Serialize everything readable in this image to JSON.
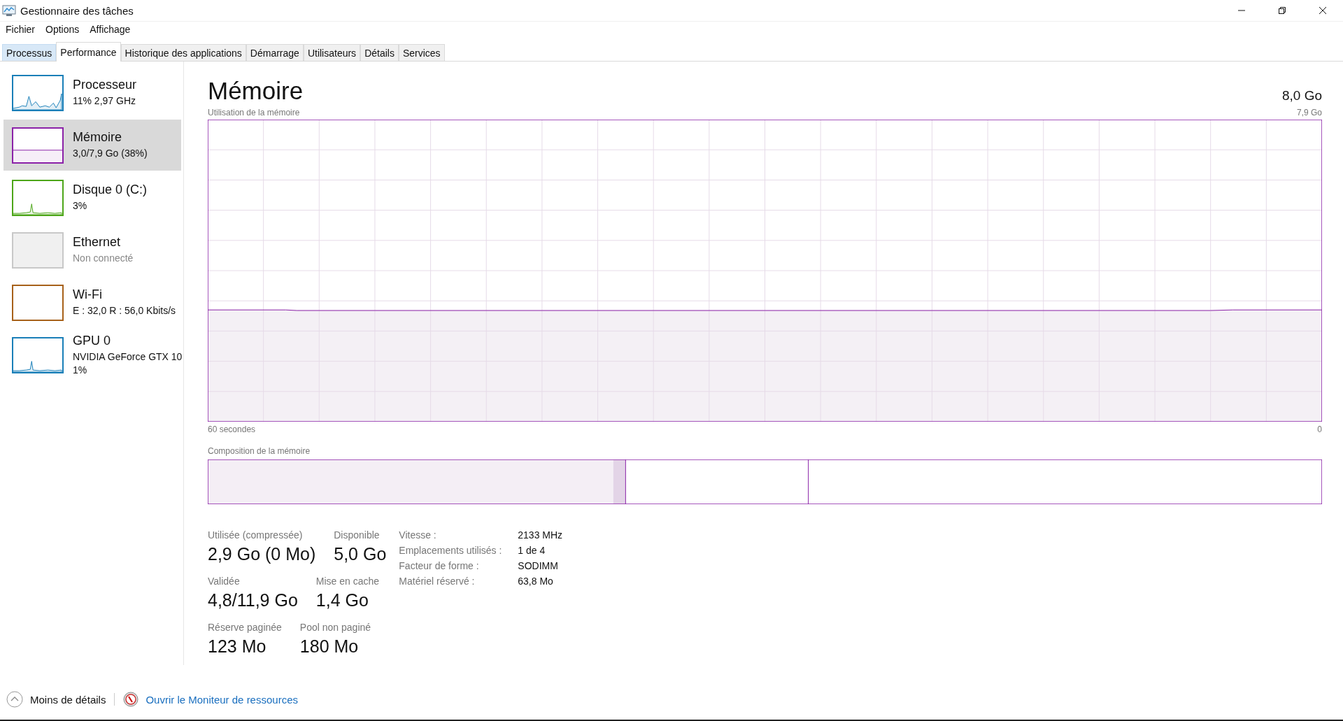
{
  "window": {
    "title": "Gestionnaire des tâches"
  },
  "menu": [
    "Fichier",
    "Options",
    "Affichage"
  ],
  "tabs": [
    {
      "label": "Processus",
      "selected": false,
      "hovered": true
    },
    {
      "label": "Performance",
      "selected": true
    },
    {
      "label": "Historique des applications",
      "selected": false,
      "hovered": false
    },
    {
      "label": "Démarrage",
      "selected": false,
      "hovered": false
    },
    {
      "label": "Utilisateurs",
      "selected": false,
      "hovered": false
    },
    {
      "label": "Détails",
      "selected": false,
      "hovered": false
    },
    {
      "label": "Services",
      "selected": false,
      "hovered": false
    }
  ],
  "sidebar": {
    "items": [
      {
        "title": "Processeur",
        "subtitle": [
          "11% 2,97 GHz"
        ],
        "kind": "spikes",
        "color": "#1a7fb8",
        "selected": false,
        "disabled": false
      },
      {
        "title": "Mémoire",
        "subtitle": [
          "3,0/7,9 Go (38%)"
        ],
        "kind": "level",
        "color": "#8b22a8",
        "selected": true,
        "disabled": false
      },
      {
        "title": "Disque 0 (C:)",
        "subtitle": [
          "3%"
        ],
        "kind": "spikes",
        "color": "#4da619",
        "selected": false,
        "disabled": false
      },
      {
        "title": "Ethernet",
        "subtitle": [
          "Non connecté"
        ],
        "kind": "blank",
        "color": "#c8c8c8",
        "selected": false,
        "disabled": true
      },
      {
        "title": "Wi-Fi",
        "subtitle": [
          "E : 32,0 R : 56,0 Kbits/s"
        ],
        "kind": "blank",
        "color": "#a7611a",
        "selected": false,
        "disabled": false
      },
      {
        "title": "GPU 0",
        "subtitle": [
          "NVIDIA GeForce GTX 10",
          "1%"
        ],
        "kind": "spikes",
        "color": "#1a7fb8",
        "selected": false,
        "disabled": false
      }
    ]
  },
  "panel": {
    "title": "Mémoire",
    "total": "8,0 Go",
    "usage_graph": {
      "label": "Utilisation de la mémoire",
      "max": "7,9 Go",
      "time_span": "60 secondes",
      "min": "0"
    },
    "composition": {
      "label": "Composition de la mémoire"
    },
    "stats": [
      [
        {
          "label": "Utilisée (compressée)",
          "value": "2,9 Go (0 Mo)"
        },
        {
          "label": "Disponible",
          "value": "5,0 Go"
        }
      ],
      [
        {
          "label": "Validée",
          "value": "4,8/11,9 Go"
        },
        {
          "label": "Mise en cache",
          "value": "1,4 Go"
        }
      ],
      [
        {
          "label": "Réserve paginée",
          "value": "123 Mo"
        },
        {
          "label": "Pool non paginé",
          "value": "180 Mo"
        }
      ]
    ],
    "details": [
      {
        "label": "Vitesse :",
        "value": "2133 MHz"
      },
      {
        "label": "Emplacements utilisés :",
        "value": "1 de 4"
      },
      {
        "label": "Facteur de forme :",
        "value": "SODIMM"
      },
      {
        "label": "Matériel réservé :",
        "value": "63,8 Mo"
      }
    ]
  },
  "footer": {
    "less_details": "Moins de détails",
    "resource_monitor": "Ouvrir le Moniteur de ressources"
  }
}
